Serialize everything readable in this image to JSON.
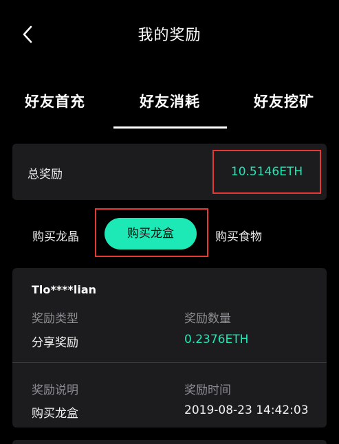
{
  "header": {
    "title": "我的奖励",
    "back_icon": "chevron-left-icon"
  },
  "tabs": [
    {
      "label": "好友首充",
      "active": false
    },
    {
      "label": "好友消耗",
      "active": true
    },
    {
      "label": "好友挖矿",
      "active": false
    }
  ],
  "total": {
    "label": "总奖励",
    "value": "10.5146ETH"
  },
  "subtabs": [
    {
      "label": "购买龙晶",
      "active": false
    },
    {
      "label": "购买龙盒",
      "active": true
    },
    {
      "label": "购买食物",
      "active": false
    }
  ],
  "record": {
    "user": "Tlo****lian",
    "type_label": "奖励类型",
    "type_value": "分享奖励",
    "amount_label": "奖励数量",
    "amount_value": "0.2376ETH",
    "desc_label": "奖励说明",
    "desc_value": "购买龙盒",
    "time_label": "奖励时间",
    "time_value": "2019-08-23 14:42:03"
  },
  "colors": {
    "accent": "#1de9b6",
    "highlight_border": "#e53935",
    "card_bg": "#1c1c1e",
    "background": "#000000"
  }
}
